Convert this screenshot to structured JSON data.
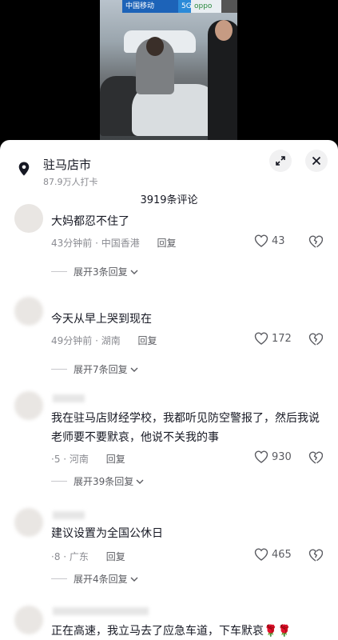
{
  "video": {
    "signs": [
      "中国移动",
      "5G",
      "oppo",
      ""
    ]
  },
  "location": {
    "name": "驻马店市",
    "subtitle": "87.9万人打卡"
  },
  "comments_count": "3919条评论",
  "comments": [
    {
      "text": "大妈都忍不住了",
      "time_loc": "43分钟前 · 中国香港",
      "reply": "回复",
      "likes": "43",
      "expand": "展开3条回复"
    },
    {
      "text": "今天从早上哭到现在",
      "time_loc": "49分钟前 · 湖南",
      "reply": "回复",
      "likes": "172",
      "expand": "展开7条回复"
    },
    {
      "text": "我在驻马店财经学校，我都听见防空警报了，然后我说老师要不要默哀，他说不关我的事",
      "time_loc": "·5 · 河南",
      "reply": "回复",
      "likes": "930",
      "expand": "展开39条回复"
    },
    {
      "text": "建议设置为全国公休日",
      "time_loc": "·8 · 广东",
      "reply": "回复",
      "likes": "465",
      "expand": "展开4条回复"
    },
    {
      "text": "正在高速，我立马去了应急车道，下车默哀🌹🌹"
    }
  ]
}
